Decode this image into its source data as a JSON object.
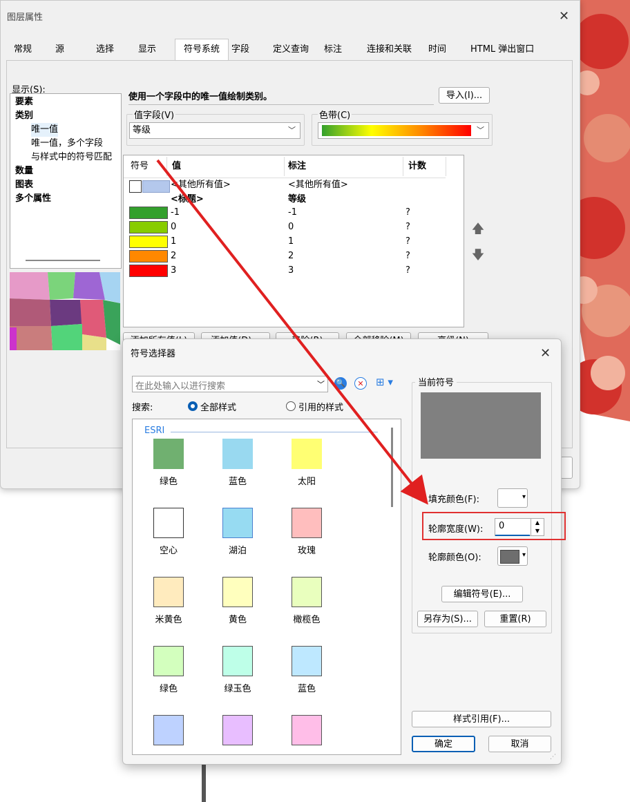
{
  "main_dialog": {
    "title": "图层属性",
    "tabs": [
      "常规",
      "源",
      "选择",
      "显示",
      "符号系统",
      "字段",
      "定义查询",
      "标注",
      "连接和关联",
      "时间",
      "HTML 弹出窗口"
    ],
    "show_label": "显示(S):",
    "show_tree": [
      {
        "label": "要素",
        "bold": true
      },
      {
        "label": "类别",
        "bold": true
      },
      {
        "label": "唯一值",
        "bold": false,
        "selected": true
      },
      {
        "label": "唯一值，多个字段",
        "bold": false
      },
      {
        "label": "与样式中的符号匹配",
        "bold": false
      },
      {
        "label": "数量",
        "bold": true
      },
      {
        "label": "图表",
        "bold": true
      },
      {
        "label": "多个属性",
        "bold": true
      }
    ],
    "description": "使用一个字段中的唯一值绘制类别。",
    "import_button": "导入(I)...",
    "value_field_label": "值字段(V)",
    "value_field_value": "等级",
    "color_ramp_label": "色带(C)",
    "table": {
      "headers": [
        "符号",
        "值",
        "标注",
        "计数"
      ],
      "all_other": {
        "value": "<其他所有值>",
        "label": "<其他所有值>"
      },
      "heading": {
        "value": "<标题>",
        "label": "等级"
      },
      "rows": [
        {
          "color": "#33a02c",
          "value": "-1",
          "label": "-1",
          "count": "?"
        },
        {
          "color": "#88cc00",
          "value": "0",
          "label": "0",
          "count": "?"
        },
        {
          "color": "#ffff00",
          "value": "1",
          "label": "1",
          "count": "?"
        },
        {
          "color": "#ff8800",
          "value": "2",
          "label": "2",
          "count": "?"
        },
        {
          "color": "#ff0000",
          "value": "3",
          "label": "3",
          "count": "?"
        }
      ]
    },
    "up_icon": "arrow-up-icon",
    "down_icon": "arrow-down-icon",
    "bottom_buttons": [
      "添加所有值(L)",
      "添加值(D)...",
      "移除(R)",
      "全部移除(M)",
      "高级(N)"
    ]
  },
  "symbol_selector": {
    "title": "符号选择器",
    "search_placeholder": "在此处输入以进行搜索",
    "search_label": "搜索:",
    "radio_all": "全部样式",
    "radio_ref": "引用的样式",
    "group_name": "ESRI",
    "symbols": [
      {
        "name": "绿色",
        "color": "#70b070",
        "border": "#70b070"
      },
      {
        "name": "蓝色",
        "color": "#99d9f0",
        "border": "#99d9f0"
      },
      {
        "name": "太阳",
        "color": "#ffff73",
        "border": "#ffff73"
      },
      {
        "name": "空心",
        "color": "#ffffff",
        "border": "#333333"
      },
      {
        "name": "湖泊",
        "color": "#97dbf2",
        "border": "#4a7fd0"
      },
      {
        "name": "玫瑰",
        "color": "#ffbebe",
        "border": "#555555"
      },
      {
        "name": "米黄色",
        "color": "#ffebbe",
        "border": "#555555"
      },
      {
        "name": "黄色",
        "color": "#ffffbe",
        "border": "#555555"
      },
      {
        "name": "橄榄色",
        "color": "#e9ffbe",
        "border": "#555555"
      },
      {
        "name": "绿色",
        "color": "#d3ffbe",
        "border": "#555555"
      },
      {
        "name": "绿玉色",
        "color": "#beffe8",
        "border": "#555555"
      },
      {
        "name": "蓝色",
        "color": "#bee8ff",
        "border": "#555555"
      },
      {
        "name": "",
        "color": "#bed2ff",
        "border": "#555555"
      },
      {
        "name": "",
        "color": "#e8beff",
        "border": "#555555"
      },
      {
        "name": "",
        "color": "#ffbee8",
        "border": "#555555"
      }
    ],
    "current_symbol_label": "当前符号",
    "fill_color_label": "填充颜色(F):",
    "outline_width_label": "轮廓宽度(W):",
    "outline_width_value": "0",
    "outline_color_label": "轮廓颜色(O):",
    "edit_symbol_button": "编辑符号(E)...",
    "save_as_button": "另存为(S)...",
    "reset_button": "重置(R)",
    "style_ref_button": "样式引用(F)...",
    "ok_button": "确定",
    "cancel_button": "取消"
  }
}
